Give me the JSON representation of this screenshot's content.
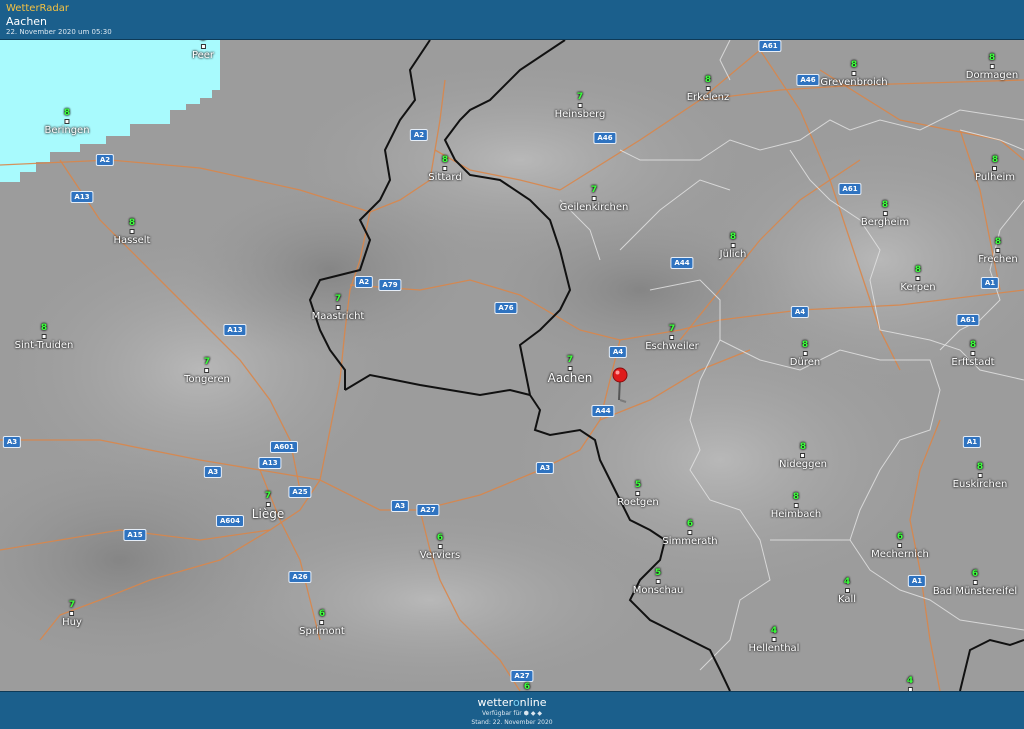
{
  "header": {
    "app_title": "WetterRadar",
    "location": "Aachen",
    "timestamp": "22. November 2020 um 05:30"
  },
  "footer": {
    "logo_prefix": "wetter",
    "logo_o": "o",
    "logo_suffix": "nline",
    "availability": "Verfügbar für ⬢ ◆ ◆",
    "stand": "Stand: 22. November 2020"
  },
  "colors": {
    "header_bg": "#1b5f8c",
    "precip_area": "#a8fafd",
    "border_line": "#111111",
    "admin_line": "#dddddd",
    "road_line": "#d9864a",
    "temperature_text": "#3cff3c",
    "road_badge": "#2f73c0",
    "pin": "#e01b1b"
  },
  "cities": [
    {
      "name": "Peer",
      "temp": "8"
    },
    {
      "name": "Beringen",
      "temp": "8"
    },
    {
      "name": "Hasselt",
      "temp": "8"
    },
    {
      "name": "Sint-Truiden",
      "temp": "8"
    },
    {
      "name": "Tongeren",
      "temp": "7"
    },
    {
      "name": "Maastricht",
      "temp": "7"
    },
    {
      "name": "Sittard",
      "temp": "8"
    },
    {
      "name": "Heinsberg",
      "temp": "7"
    },
    {
      "name": "Geilenkirchen",
      "temp": "7"
    },
    {
      "name": "Erkelenz",
      "temp": "8"
    },
    {
      "name": "Grevenbroich",
      "temp": "8"
    },
    {
      "name": "Dormagen",
      "temp": "8"
    },
    {
      "name": "Pulheim",
      "temp": "8"
    },
    {
      "name": "Bergheim",
      "temp": "8"
    },
    {
      "name": "Jülich",
      "temp": "8"
    },
    {
      "name": "Frechen",
      "temp": "8"
    },
    {
      "name": "Kerpen",
      "temp": "8"
    },
    {
      "name": "Eschweiler",
      "temp": "7"
    },
    {
      "name": "Aachen",
      "temp": "7"
    },
    {
      "name": "Düren",
      "temp": "8"
    },
    {
      "name": "Erftstadt",
      "temp": "8"
    },
    {
      "name": "Nideggen",
      "temp": "8"
    },
    {
      "name": "Euskirchen",
      "temp": "8"
    },
    {
      "name": "Roetgen",
      "temp": "5"
    },
    {
      "name": "Heimbach",
      "temp": "8"
    },
    {
      "name": "Liège",
      "temp": "7"
    },
    {
      "name": "Verviers",
      "temp": "6"
    },
    {
      "name": "Simmerath",
      "temp": "6"
    },
    {
      "name": "Mechernich",
      "temp": "6"
    },
    {
      "name": "Monschau",
      "temp": "5"
    },
    {
      "name": "Kall",
      "temp": "4"
    },
    {
      "name": "Bad Münstereifel",
      "temp": "6"
    },
    {
      "name": "Huy",
      "temp": "7"
    },
    {
      "name": "Sprimont",
      "temp": "6"
    },
    {
      "name": "Hellenthal",
      "temp": "4"
    },
    {
      "name": "",
      "temp": "6"
    },
    {
      "name": "",
      "temp": "4"
    }
  ],
  "roads": [
    "A61",
    "A46",
    "A2",
    "A46",
    "A2",
    "A13",
    "A61",
    "A44",
    "A2",
    "A79",
    "A76",
    "A4",
    "A1",
    "A61",
    "A13",
    "A4",
    "A44",
    "A3",
    "A601",
    "A13",
    "A3",
    "A1",
    "A3",
    "A25",
    "A3",
    "A27",
    "A604",
    "A15",
    "A1",
    "A26",
    "A27"
  ]
}
